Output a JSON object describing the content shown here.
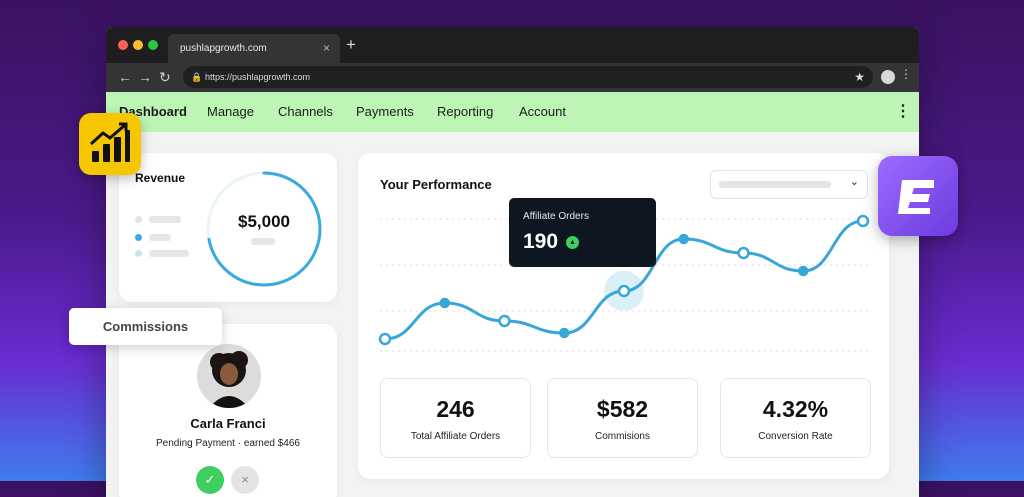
{
  "browser": {
    "tab_title": "pushlapgrowth.com",
    "tab_close": "×",
    "new_tab": "+",
    "url": "https://pushlapgrowth.com",
    "nav_icons": [
      "back-icon",
      "forward-icon",
      "reload-icon"
    ],
    "nav_glyphs": [
      "←",
      "→",
      "↻"
    ],
    "lock_glyph": "🔒",
    "star_glyph": "★",
    "menu_glyph": "⋮"
  },
  "nav": {
    "items": [
      "Dashboard",
      "Manage",
      "Channels",
      "Payments",
      "Reporting",
      "Account"
    ],
    "active": "Dashboard",
    "menu_glyph": "⋮"
  },
  "revenue": {
    "title": "Revenue",
    "value": "$5,000",
    "progress": 0.72,
    "accent": "#3aa9dc"
  },
  "commissions_label": "Commissions",
  "affiliate": {
    "name": "Carla Franci",
    "status": "Pending Payment · earned $466",
    "approve_glyph": "✓",
    "reject_glyph": "×"
  },
  "performance": {
    "title": "Your Performance",
    "tooltip_label": "Affiliate Orders",
    "tooltip_value": "190",
    "tooltip_glyph": "▲",
    "dropdown_glyph": "⌄",
    "line_color": "#39a6d8",
    "points": [
      12,
      48,
      30,
      18,
      60,
      112,
      98,
      80,
      130
    ],
    "highlight_index": 4
  },
  "stats": [
    {
      "value": "246",
      "label": "Total Affiliate Orders"
    },
    {
      "value": "$582",
      "label": "Commisions"
    },
    {
      "value": "4.32%",
      "label": "Conversion Rate"
    }
  ],
  "colors": {
    "nav_bg": "#bdf5b5",
    "brand_yellow": "#f6c700",
    "brand_purple": "#7c4ff0",
    "success": "#3ecf5e"
  }
}
